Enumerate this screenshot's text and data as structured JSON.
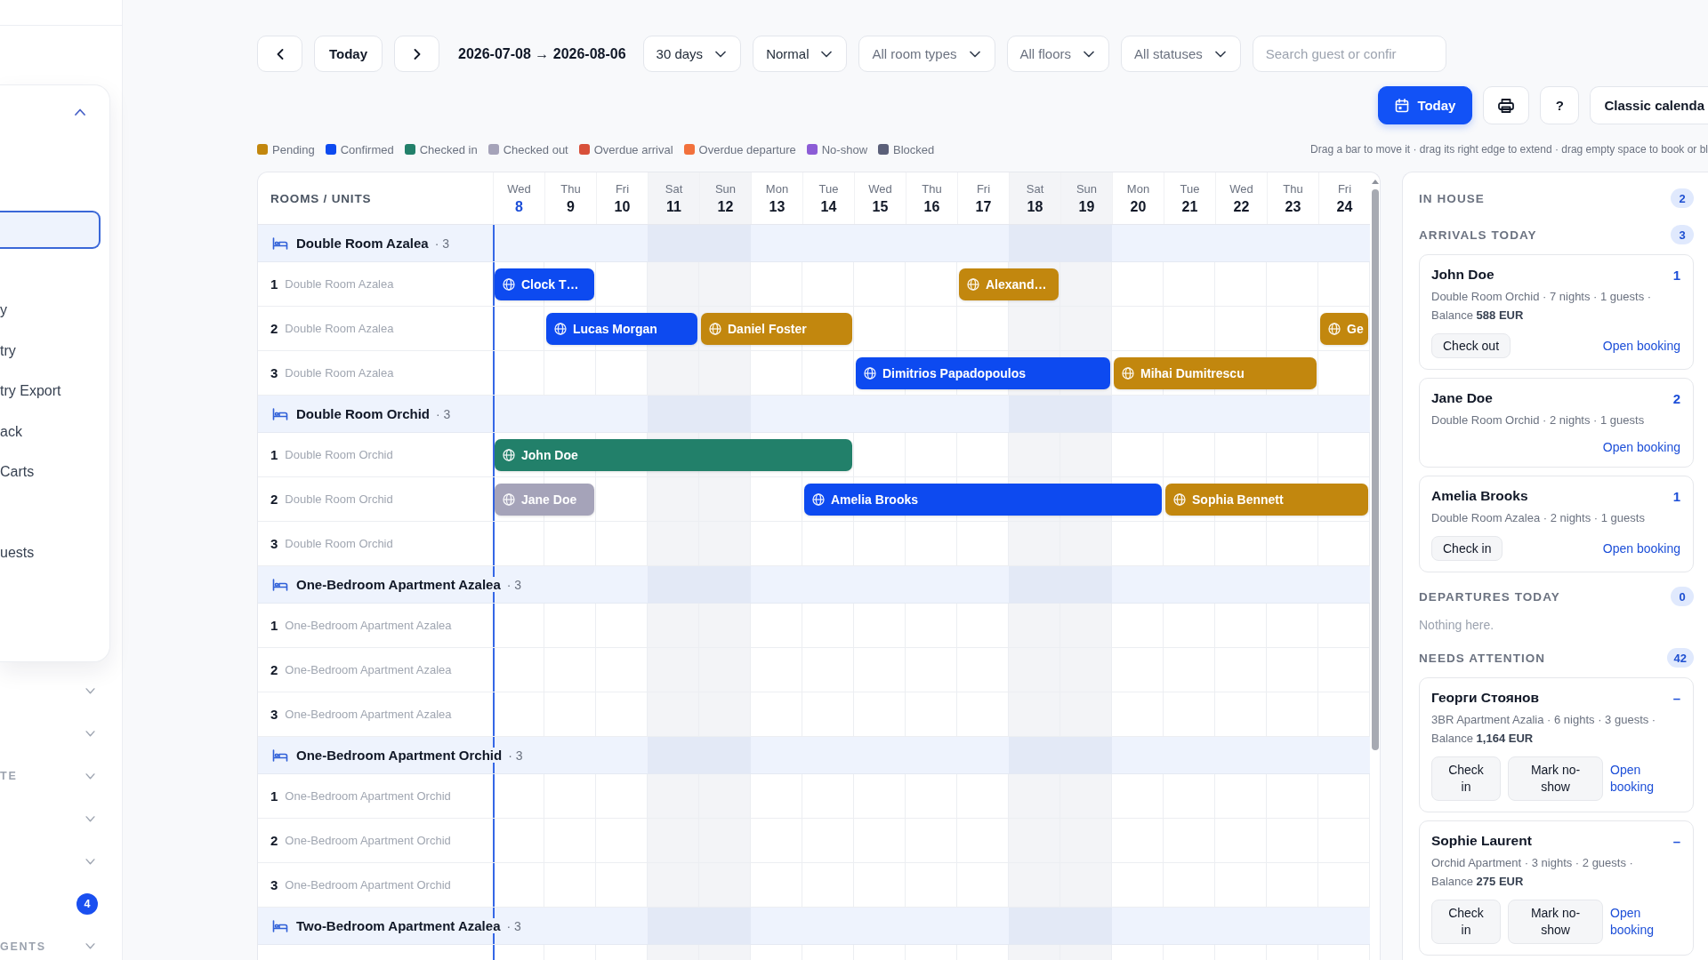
{
  "sidebar": {
    "menu": {
      "expanded": true,
      "items": [
        {
          "selected": true
        },
        {
          "label": "y",
          "selected": false
        },
        {
          "label": "try",
          "selected": false
        },
        {
          "label": "try Export",
          "selected": false
        },
        {
          "label": "ack",
          "selected": false
        },
        {
          "label": "Carts",
          "selected": false
        },
        {
          "label": "uests",
          "selected": false
        }
      ]
    },
    "sections": [
      {
        "kind": "group",
        "expanded": false
      },
      {
        "kind": "group",
        "expanded": false
      },
      {
        "kind": "group",
        "label": "TE",
        "expanded": false
      },
      {
        "kind": "group",
        "expanded": false
      },
      {
        "kind": "group",
        "expanded": false
      },
      {
        "kind": "badge",
        "badge": "4"
      },
      {
        "kind": "group",
        "label": "GENTS",
        "expanded": false
      }
    ]
  },
  "toolbar": {
    "today": "Today",
    "range": "2026-07-08 → 2026-08-06",
    "filters": [
      {
        "kind": "select",
        "value": "30 days"
      },
      {
        "kind": "select",
        "value": "Normal"
      },
      {
        "kind": "select",
        "placeholder": "All room types"
      },
      {
        "kind": "select",
        "placeholder": "All floors"
      },
      {
        "kind": "select",
        "placeholder": "All statuses"
      },
      {
        "kind": "search",
        "placeholder": "Search guest or confir"
      }
    ],
    "actions": [
      {
        "kind": "primary",
        "label": "Today"
      },
      {
        "kind": "print"
      },
      {
        "kind": "plain",
        "label": "?"
      },
      {
        "kind": "plain",
        "label": "Classic calenda"
      }
    ]
  },
  "legend": [
    {
      "label": "Pending",
      "color": "#c2870e"
    },
    {
      "label": "Confirmed",
      "color": "#0d4af0"
    },
    {
      "label": "Checked in",
      "color": "#22806a"
    },
    {
      "label": "Checked out",
      "color": "#a5a3b9"
    },
    {
      "label": "Overdue arrival",
      "color": "#d8503a"
    },
    {
      "label": "Overdue departure",
      "color": "#f2713c"
    },
    {
      "label": "No-show",
      "color": "#8c5cd6"
    },
    {
      "label": "Blocked",
      "color": "#5b6079"
    }
  ],
  "hint": "Drag a bar to move it · drag its right edge to extend · drag empty space to book or bl",
  "calendar": {
    "column_header": "ROOMS / UNITS",
    "days": [
      {
        "weekday": "Wed",
        "day": "8",
        "today": true,
        "weekend": false
      },
      {
        "weekday": "Thu",
        "day": "9",
        "today": false,
        "weekend": false
      },
      {
        "weekday": "Fri",
        "day": "10",
        "today": false,
        "weekend": false
      },
      {
        "weekday": "Sat",
        "day": "11",
        "today": false,
        "weekend": true
      },
      {
        "weekday": "Sun",
        "day": "12",
        "today": false,
        "weekend": true
      },
      {
        "weekday": "Mon",
        "day": "13",
        "today": false,
        "weekend": false
      },
      {
        "weekday": "Tue",
        "day": "14",
        "today": false,
        "weekend": false
      },
      {
        "weekday": "Wed",
        "day": "15",
        "today": false,
        "weekend": false
      },
      {
        "weekday": "Thu",
        "day": "16",
        "today": false,
        "weekend": false
      },
      {
        "weekday": "Fri",
        "day": "17",
        "today": false,
        "weekend": false
      },
      {
        "weekday": "Sat",
        "day": "18",
        "today": false,
        "weekend": true
      },
      {
        "weekday": "Sun",
        "day": "19",
        "today": false,
        "weekend": true
      },
      {
        "weekday": "Mon",
        "day": "20",
        "today": false,
        "weekend": false
      },
      {
        "weekday": "Tue",
        "day": "21",
        "today": false,
        "weekend": false
      },
      {
        "weekday": "Wed",
        "day": "22",
        "today": false,
        "weekend": false
      },
      {
        "weekday": "Thu",
        "day": "23",
        "today": false,
        "weekend": false
      },
      {
        "weekday": "Fri",
        "day": "24",
        "today": false,
        "weekend": false
      }
    ],
    "groups": [
      {
        "name": "Double Room Azalea",
        "count": "· 3",
        "units": [
          {
            "number": "1",
            "name": "Double Room Azalea",
            "bookings": [
              {
                "name": "Clock T…",
                "color": "#0d4af0"
              },
              {
                "name": "Alexand…",
                "color": "#c2870e"
              }
            ]
          },
          {
            "number": "2",
            "name": "Double Room Azalea",
            "bookings": [
              {
                "name": "Lucas Morgan",
                "color": "#0d4af0"
              },
              {
                "name": "Daniel Foster",
                "color": "#c2870e"
              },
              {
                "name": "Ge",
                "color": "#c2870e"
              }
            ]
          },
          {
            "number": "3",
            "name": "Double Room Azalea",
            "bookings": [
              {
                "name": "Dimitrios Papadopoulos",
                "color": "#0d4af0"
              },
              {
                "name": "Mihai Dumitrescu",
                "color": "#c2870e"
              }
            ]
          }
        ]
      },
      {
        "name": "Double Room Orchid",
        "count": "· 3",
        "units": [
          {
            "number": "1",
            "name": "Double Room Orchid",
            "bookings": [
              {
                "name": "John Doe",
                "color": "#22806a"
              }
            ]
          },
          {
            "number": "2",
            "name": "Double Room Orchid",
            "bookings": [
              {
                "name": "Jane Doe",
                "color": "#a5a3b9"
              },
              {
                "name": "Amelia Brooks",
                "color": "#0d4af0"
              },
              {
                "name": "Sophia Bennett",
                "color": "#c2870e"
              }
            ]
          },
          {
            "number": "3",
            "name": "Double Room Orchid"
          }
        ]
      },
      {
        "name": "One-Bedroom Apartment Azalea",
        "count": "· 3",
        "units": [
          {
            "number": "1",
            "name": "One-Bedroom Apartment Azalea"
          },
          {
            "number": "2",
            "name": "One-Bedroom Apartment Azalea"
          },
          {
            "number": "3",
            "name": "One-Bedroom Apartment Azalea"
          }
        ]
      },
      {
        "name": "One-Bedroom Apartment Orchid",
        "count": "· 3",
        "units": [
          {
            "number": "1",
            "name": "One-Bedroom Apartment Orchid"
          },
          {
            "number": "2",
            "name": "One-Bedroom Apartment Orchid"
          },
          {
            "number": "3",
            "name": "One-Bedroom Apartment Orchid"
          }
        ]
      },
      {
        "name": "Two-Bedroom Apartment Azalea",
        "count": "· 3"
      }
    ]
  },
  "panel": {
    "sections": [
      {
        "title": "IN HOUSE",
        "count": "2"
      },
      {
        "title": "ARRIVALS TODAY",
        "count": "3",
        "cards": [
          {
            "name": "John Doe",
            "tag": "1",
            "details": "Double Room Orchid · 7 nights · 1 guests ·",
            "balance": "Balance **588 EUR**",
            "actions": [
              "Check out"
            ],
            "link": "Open booking"
          },
          {
            "name": "Jane Doe",
            "tag": "2",
            "details": "Double Room Orchid · 2 nights · 1 guests",
            "link": "Open booking"
          },
          {
            "name": "Amelia Brooks",
            "tag": "1",
            "details": "Double Room Azalea · 2 nights · 1 guests",
            "actions": [
              "Check in"
            ],
            "link": "Open booking"
          }
        ]
      },
      {
        "title": "DEPARTURES TODAY",
        "count": "0",
        "empty_text": "Nothing here."
      },
      {
        "title": "NEEDS ATTENTION",
        "count": "42",
        "cards": [
          {
            "name": "Георги Стоянов",
            "tag": "–",
            "details": "3BR Apartment Azalia · 6 nights · 3 guests ·",
            "balance": "Balance **1,164 EUR**",
            "actions": [
              "Check in",
              "Mark no-show"
            ],
            "link": "Open booking"
          },
          {
            "name": "Sophie Laurent",
            "tag": "–",
            "details": "Orchid Apartment · 3 nights · 2 guests ·",
            "balance": "Balance **275 EUR**",
            "actions": [
              "Check in",
              "Mark no-show"
            ],
            "link": "Open booking"
          }
        ]
      }
    ]
  }
}
